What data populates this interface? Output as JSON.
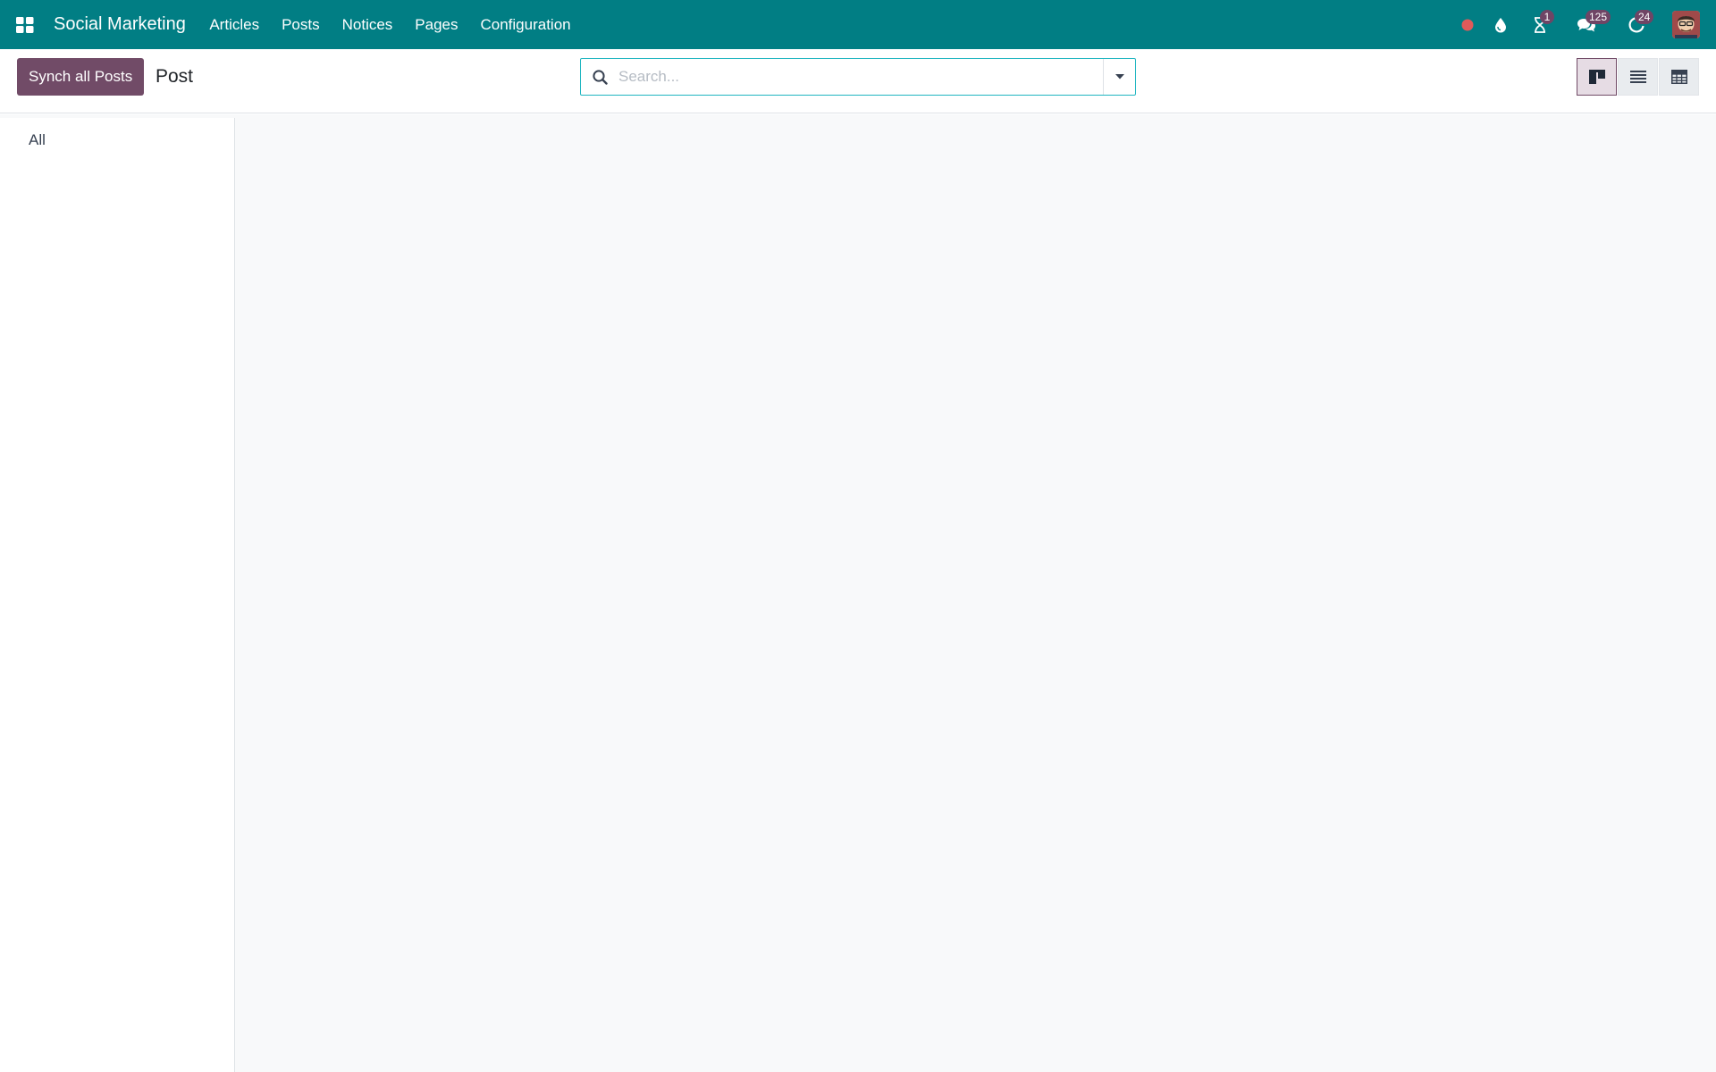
{
  "navbar": {
    "app_name": "Social Marketing",
    "menu": [
      "Articles",
      "Posts",
      "Notices",
      "Pages",
      "Configuration"
    ],
    "systray": {
      "activity_badge": "1",
      "messages_badge": "125",
      "updates_badge": "24"
    },
    "colors": {
      "navbar_bg": "#017e84",
      "badge_bg": "#6f4565",
      "status_dot": "#e05a5a"
    }
  },
  "control_panel": {
    "primary_button": "Synch all Posts",
    "breadcrumb": "Post",
    "search": {
      "placeholder": "Search...",
      "value": ""
    },
    "views": [
      "kanban-view",
      "list-view",
      "pivot-view"
    ],
    "active_view": "kanban-view",
    "colors": {
      "primary": "#714b67",
      "search_border": "#21b6c1"
    }
  },
  "side_panel": {
    "items": [
      {
        "label": "All"
      }
    ]
  }
}
